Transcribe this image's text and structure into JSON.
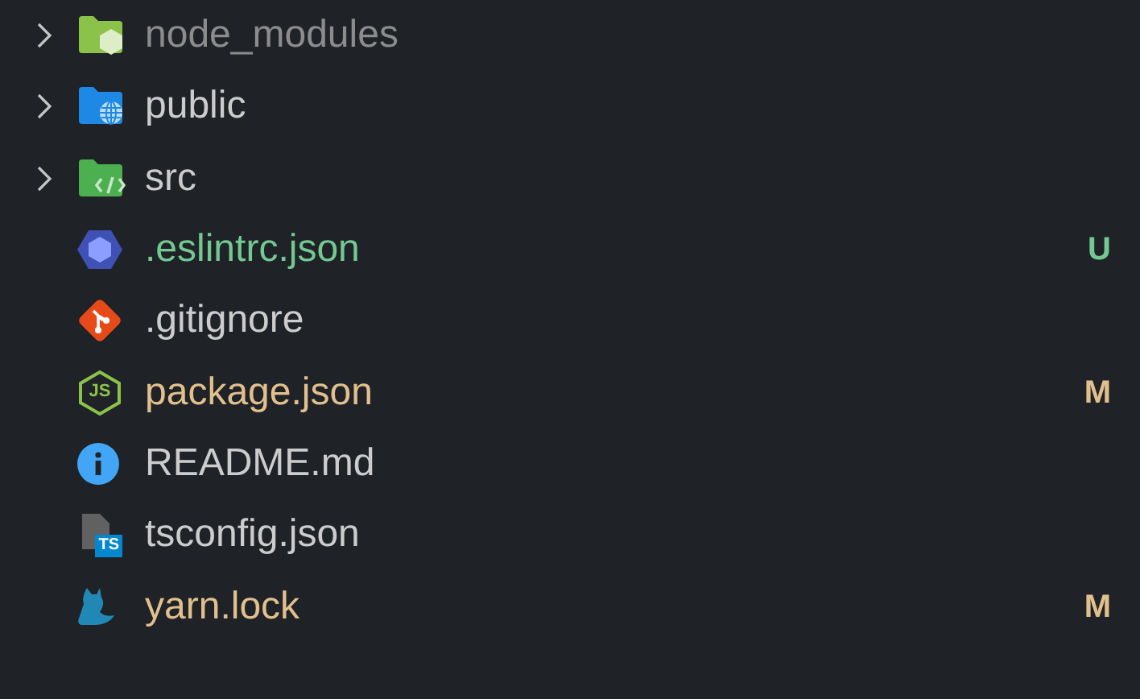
{
  "explorer": {
    "items": [
      {
        "kind": "folder",
        "name": "node_modules",
        "color": "#8c8c8c",
        "expanded": false
      },
      {
        "kind": "folder",
        "name": "public",
        "color": "#cccccc",
        "expanded": false
      },
      {
        "kind": "folder",
        "name": "src",
        "color": "#cccccc",
        "expanded": false
      },
      {
        "kind": "file",
        "name": ".eslintrc.json",
        "color": "#73c991",
        "badge": "U"
      },
      {
        "kind": "file",
        "name": ".gitignore",
        "color": "#cccccc"
      },
      {
        "kind": "file",
        "icon_text": "JS",
        "name": "package.json",
        "color": "#e2c08d",
        "badge": "M"
      },
      {
        "kind": "file",
        "name": "README.md",
        "color": "#cccccc"
      },
      {
        "kind": "file",
        "icon_text": "TS",
        "name": "tsconfig.json",
        "color": "#cccccc"
      },
      {
        "kind": "file",
        "name": "yarn.lock",
        "color": "#e2c08d",
        "badge": "M"
      }
    ]
  }
}
